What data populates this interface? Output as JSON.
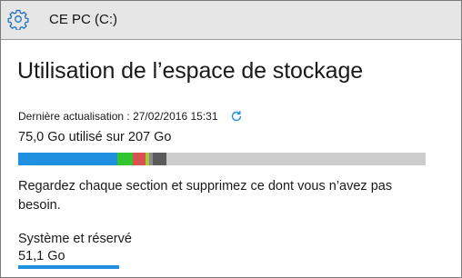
{
  "window": {
    "title": "CE PC (C:)",
    "icon": "gear-icon",
    "accent_color": "#1f8fe0"
  },
  "storage": {
    "heading": "Utilisation de l’espace de stockage",
    "updated_label": "Dernière actualisation : 27/02/2016 15:31",
    "refresh_icon": "refresh-icon",
    "usage_text": "75,0 Go utilisé sur 207 Go",
    "bar": {
      "total_gb": 207,
      "used_gb": 75.0,
      "free_color": "#cccccc",
      "segments": [
        {
          "share": 0.244,
          "color": "#1f8fe0"
        },
        {
          "share": 0.038,
          "color": "#34c42f"
        },
        {
          "share": 0.031,
          "color": "#d85252"
        },
        {
          "share": 0.009,
          "color": "#a8c83c"
        },
        {
          "share": 0.009,
          "color": "#8a8a8a"
        },
        {
          "share": 0.033,
          "color": "#5a5a5a"
        }
      ]
    },
    "hint": "Regardez chaque section et supprimez ce dont vous n’avez pas besoin.",
    "categories": [
      {
        "name": "Système et réservé",
        "size": "51,1 Go",
        "usage_share": 0.248,
        "color": "#1f8fe0"
      }
    ]
  }
}
